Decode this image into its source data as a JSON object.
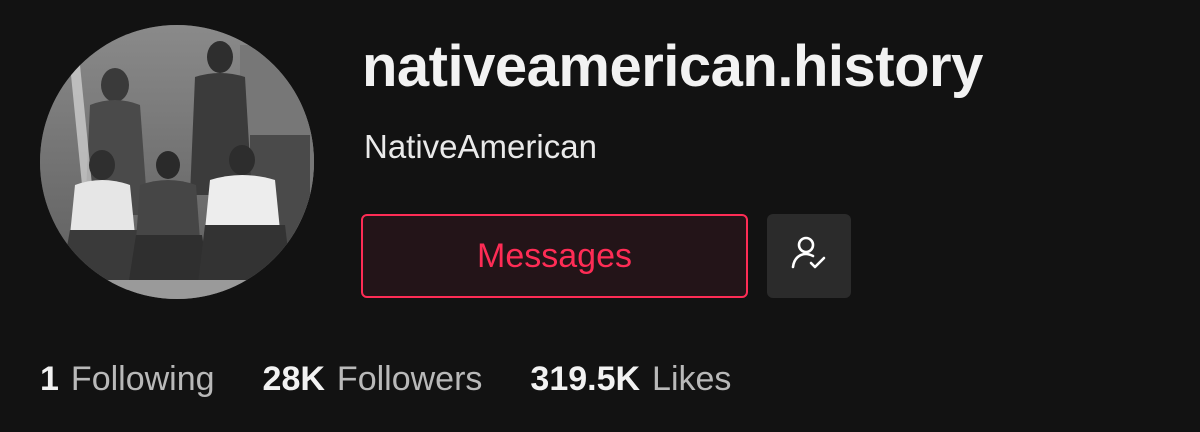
{
  "profile": {
    "username": "nativeamerican.history",
    "nickname": "NativeAmerican",
    "avatar_icon": "historical-group-photo",
    "messages_label": "Messages",
    "follow_icon": "user-check-icon",
    "accent_color": "#fe2c55"
  },
  "stats": [
    {
      "value": "1",
      "label": "Following"
    },
    {
      "value": "28K",
      "label": "Followers"
    },
    {
      "value": "319.5K",
      "label": "Likes"
    }
  ]
}
